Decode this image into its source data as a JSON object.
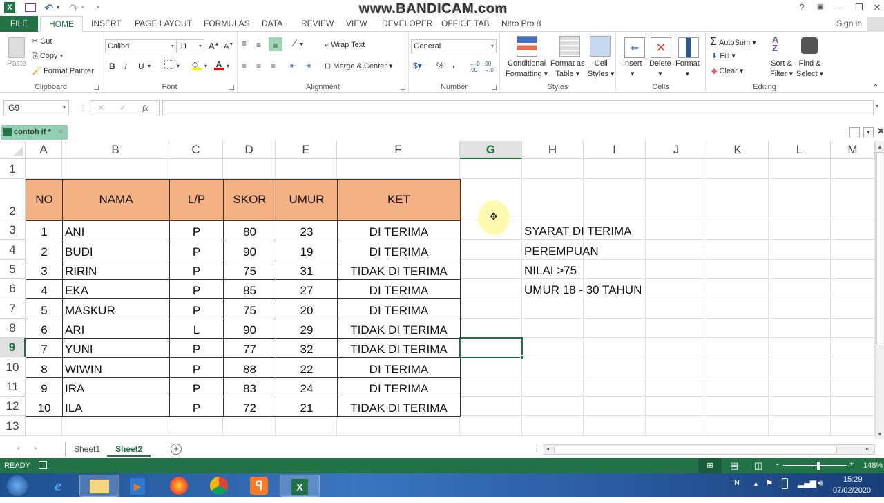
{
  "app": {
    "watermark": "www.BANDICAM.com",
    "window_buttons": {
      "help": "?",
      "ribbon_options": "▣",
      "minimize": "–",
      "restore": "❐",
      "close": "✕"
    }
  },
  "quick_access": {
    "save_icon": "💾",
    "undo_icon": "↶",
    "redo_icon": "↷",
    "customize": "⌄"
  },
  "tabs": [
    {
      "label": "FILE"
    },
    {
      "label": "HOME"
    },
    {
      "label": "INSERT"
    },
    {
      "label": "PAGE LAYOUT"
    },
    {
      "label": "FORMULAS"
    },
    {
      "label": "DATA"
    },
    {
      "label": "REVIEW"
    },
    {
      "label": "VIEW"
    },
    {
      "label": "DEVELOPER"
    },
    {
      "label": "OFFICE TAB"
    },
    {
      "label": "Nitro Pro 8"
    }
  ],
  "active_tab": "HOME",
  "sign_in": "Sign in",
  "ribbon": {
    "clipboard": {
      "label": "Clipboard",
      "paste": "Paste",
      "cut": "Cut",
      "copy": "Copy",
      "format_painter": "Format Painter"
    },
    "font": {
      "label": "Font",
      "font_name": "Calibri",
      "font_size": "11",
      "bold": "B",
      "italic": "I",
      "underline": "U",
      "grow": "A",
      "shrink": "A"
    },
    "alignment": {
      "label": "Alignment",
      "wrap_text": "Wrap Text",
      "merge_center": "Merge & Center"
    },
    "number": {
      "label": "Number",
      "format": "General",
      "percent": "%",
      "comma": ",",
      "inc_decimal": "←.0 .00",
      "dec_decimal": ".00 →.0"
    },
    "styles": {
      "label": "Styles",
      "conditional_formatting": [
        "Conditional",
        "Formatting"
      ],
      "format_as_table": [
        "Format as",
        "Table"
      ],
      "cell_styles": [
        "Cell",
        "Styles"
      ]
    },
    "cells": {
      "label": "Cells",
      "insert": "Insert",
      "delete": "Delete",
      "format": "Format"
    },
    "editing": {
      "label": "Editing",
      "autosum": "AutoSum",
      "fill": "Fill",
      "clear": "Clear",
      "sort_filter": [
        "Sort &",
        "Filter"
      ],
      "find_select": [
        "Find &",
        "Select"
      ]
    }
  },
  "formula_bar": {
    "name_box": "G9",
    "cancel": "✕",
    "enter": "✓",
    "fx": "fx",
    "value": ""
  },
  "document_tab": {
    "name": "contoh if *",
    "close": "✕"
  },
  "columns": [
    "A",
    "B",
    "C",
    "D",
    "E",
    "F",
    "G",
    "H",
    "I",
    "J",
    "K",
    "L",
    "M"
  ],
  "selected_column": "G",
  "rows": [
    "1",
    "2",
    "3",
    "4",
    "5",
    "6",
    "7",
    "8",
    "9",
    "10",
    "11",
    "12",
    "13"
  ],
  "selected_row": "9",
  "table": {
    "headers": [
      "NO",
      "NAMA",
      "L/P",
      "SKOR",
      "UMUR",
      "KET"
    ],
    "header_color": "#f4b183",
    "rows": [
      [
        "1",
        "ANI",
        "P",
        "80",
        "23",
        "DI TERIMA"
      ],
      [
        "2",
        "BUDI",
        "P",
        "90",
        "19",
        "DI TERIMA"
      ],
      [
        "3",
        "RIRIN",
        "P",
        "75",
        "31",
        "TIDAK DI TERIMA"
      ],
      [
        "4",
        "EKA",
        "P",
        "85",
        "27",
        "DI TERIMA"
      ],
      [
        "5",
        "MASKUR",
        "P",
        "75",
        "20",
        "DI TERIMA"
      ],
      [
        "6",
        "ARI",
        "L",
        "90",
        "29",
        "TIDAK DI TERIMA"
      ],
      [
        "7",
        "YUNI",
        "P",
        "77",
        "32",
        "TIDAK DI TERIMA"
      ],
      [
        "8",
        "WIWIN",
        "P",
        "88",
        "22",
        "DI TERIMA"
      ],
      [
        "9",
        "IRA",
        "P",
        "83",
        "24",
        "DI TERIMA"
      ],
      [
        "10",
        "ILA",
        "P",
        "72",
        "21",
        "TIDAK DI TERIMA"
      ]
    ]
  },
  "notes": [
    "SYARAT DI TERIMA",
    "PEREMPUAN",
    "NILAI >75",
    "UMUR 18 - 30 TAHUN"
  ],
  "sheets": [
    {
      "name": "Sheet1"
    },
    {
      "name": "Sheet2"
    }
  ],
  "active_sheet": "Sheet2",
  "status": {
    "mode": "READY",
    "zoom": "148%",
    "zoom_minus": "-",
    "zoom_plus": "+",
    "zoom_level_percent": 148
  },
  "taskbar": {
    "apps": [
      "Start",
      "Internet Explorer",
      "Windows Explorer",
      "Media Player",
      "Firefox",
      "Chrome",
      "XAMPP",
      "Excel"
    ],
    "lang": "IN",
    "time": "15:29",
    "date": "07/02/2020"
  },
  "accent_color": "#217346"
}
